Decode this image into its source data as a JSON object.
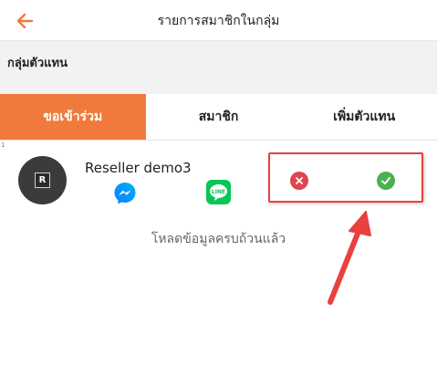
{
  "header": {
    "title": "รายการสมาชิกในกลุ่ม",
    "back_icon": "arrow-left-icon",
    "accent_color": "#f07a3c"
  },
  "group": {
    "name": "กลุ่มตัวแทน"
  },
  "tabs": [
    {
      "label": "ขอเข้าร่วม",
      "active": true
    },
    {
      "label": "สมาชิก",
      "active": false
    },
    {
      "label": "เพิ่มตัวแทน",
      "active": false
    }
  ],
  "request_list": {
    "row_index": "1",
    "items": [
      {
        "avatar_letter": "R",
        "name": "Reseller demo3",
        "contact_icons": [
          "messenger-icon",
          "line-icon"
        ],
        "line_label": "LINE",
        "reject_icon": "close-icon",
        "accept_icon": "check-icon"
      }
    ]
  },
  "status": {
    "message": "โหลดข้อมูลครบถ้วนแล้ว"
  },
  "colors": {
    "active_tab": "#f07a3c",
    "reject": "#e0454f",
    "accept": "#4caf50",
    "annotation": "#e8413f"
  }
}
